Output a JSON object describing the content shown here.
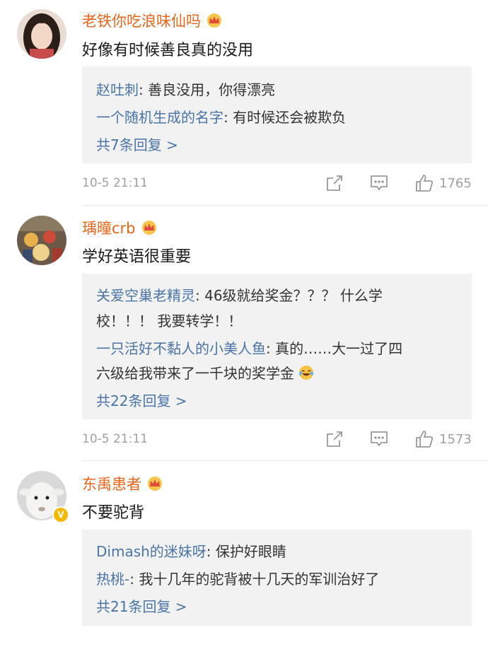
{
  "comments": [
    {
      "username": "老铁你吃浪味仙吗",
      "text": "好像有时候善良真的没用",
      "replies": [
        {
          "user": "赵吐刺",
          "text": ": 善良没用，你得漂亮"
        },
        {
          "user": "一个随机生成的名字",
          "text": ": 有时候还会被欺负"
        }
      ],
      "more": "共7条回复 >",
      "time": "10-5 21:11",
      "likes": "1765"
    },
    {
      "username": "瑀曈crb",
      "text": "学好英语很重要",
      "replies": [
        {
          "user": "关爱空巢老精灵",
          "text": ": 46级就给奖金？？？ 什么学",
          "cont": "校！！！ 我要转学！！"
        },
        {
          "user": "一只活好不黏人的小美人鱼",
          "text": ": 真的……大一过了四",
          "cont": "六级给我带来了一千块的奖学金"
        }
      ],
      "more": "共22条回复 >",
      "time": "10-5 21:11",
      "likes": "1573"
    },
    {
      "username": "东禹患者",
      "text": "不要驼背",
      "replies": [
        {
          "user": "Dimash的迷妹呀",
          "text": ": 保护好眼睛"
        },
        {
          "user": "热桃-",
          "text": ": 我十几年的驼背被十几天的军训治好了"
        }
      ],
      "more": "共21条回复 >"
    }
  ],
  "icons": {
    "crown": "vip-crown-icon",
    "share": "share-icon",
    "comment": "comment-icon",
    "like": "thumbs-up-icon",
    "verified": "verified-badge-icon",
    "emoji": "laughing-tears-emoji"
  },
  "colors": {
    "username": "#e8651a",
    "reply_user": "#4a74a8",
    "reply_bg": "#f2f2f2",
    "meta": "#a0a0a0"
  }
}
